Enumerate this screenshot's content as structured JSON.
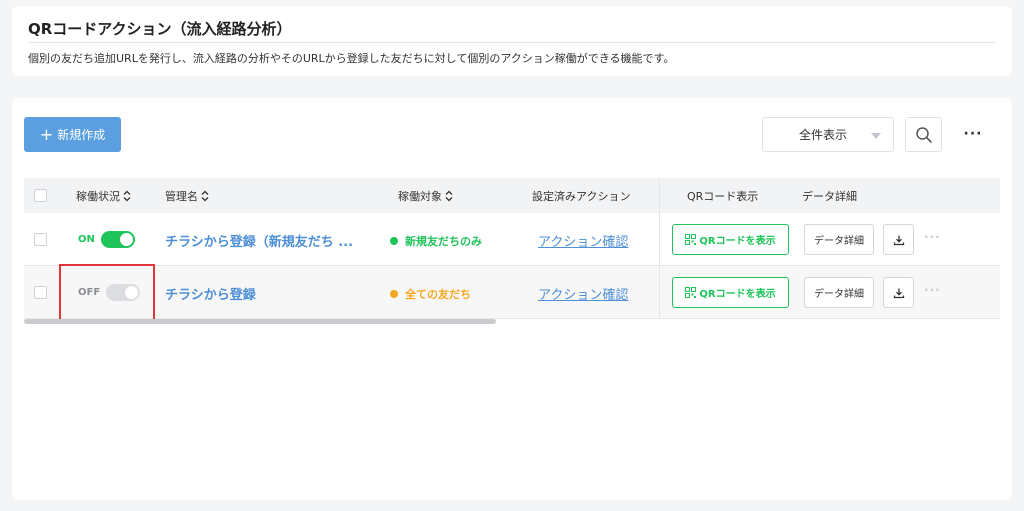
{
  "header": {
    "title": "QRコードアクション（流入経路分析）",
    "description": "個別の友だち追加URLを発行し、流入経路の分析やそのURLから登録した友だちに対して個別のアクション稼働ができる機能です。"
  },
  "toolbar": {
    "new_button_plus": "+",
    "new_button_label": "新規作成",
    "filter_value": "全件表示",
    "more_label": "···"
  },
  "table": {
    "columns": {
      "status": "稼働状況",
      "name": "管理名",
      "target": "稼働対象",
      "actions": "設定済みアクション",
      "qr": "QRコード表示",
      "detail": "データ詳細"
    },
    "rows": [
      {
        "toggle_label": "ON",
        "toggle_on": true,
        "name": "チラシから登録（新規友だち ...",
        "target": "新規友だちのみ",
        "target_color": "#1ec45a",
        "action_link": "アクション確認",
        "qr_button": "QRコードを表示",
        "detail_button": "データ詳細",
        "more": "···"
      },
      {
        "toggle_label": "OFF",
        "toggle_on": false,
        "name": "チラシから登録",
        "target": "全ての友だち",
        "target_color": "#f5a623",
        "action_link": "アクション確認",
        "qr_button": "QRコードを表示",
        "detail_button": "データ詳細",
        "more": "···"
      }
    ]
  },
  "colors": {
    "primary": "#5b9fe0",
    "link": "#4d8fd6",
    "success": "#1ec45a",
    "warning": "#f5a623",
    "highlight": "#e0353b"
  }
}
